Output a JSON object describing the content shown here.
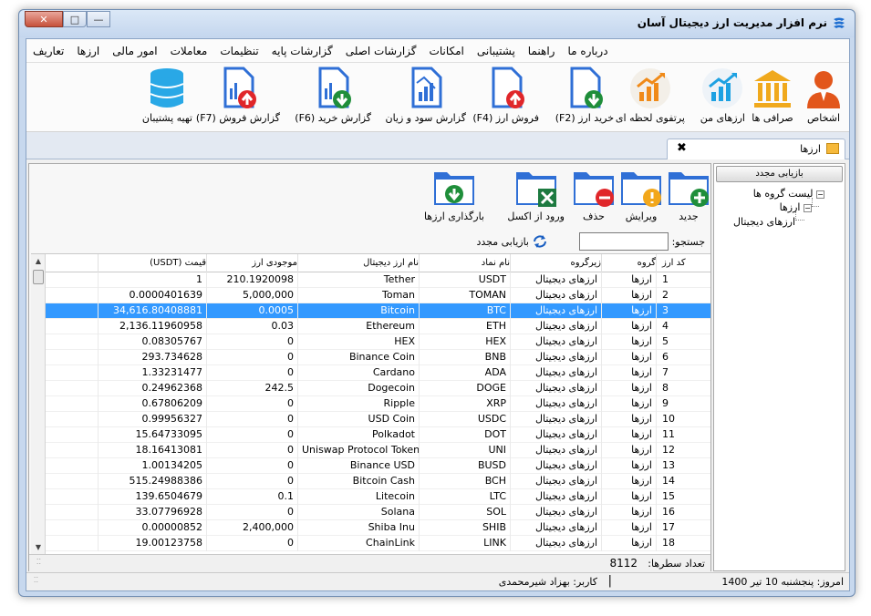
{
  "window": {
    "title": "نرم افزار مدیریت ارز دیجیتال آسان",
    "close_glyph": "✕",
    "max_glyph": "□",
    "min_glyph": "—"
  },
  "menu": [
    "تعاریف",
    "ارزها",
    "امور مالی",
    "معاملات",
    "تنظیمات",
    "گزارشات پایه",
    "گزارشات اصلی",
    "امکانات",
    "پشتیبانی",
    "راهنما",
    "درباره ما"
  ],
  "ribbon": {
    "people": "اشخاص",
    "exchanges": "صرافی ها",
    "my_coins": "ارزهای من",
    "live_portfolio": "پرتفوی لحظه ای",
    "buy": "خرید ارز (F2)",
    "sell": "فروش ارز (F4)",
    "pnl_report": "گزارش سود و زیان",
    "buy_report": "گزارش خرید (F6)",
    "sell_report": "گزارش فروش (F7)",
    "backup": "تهیه پشتیبان"
  },
  "tab": {
    "label": "ارزها",
    "close": "✖"
  },
  "tree": {
    "refresh": "بازیابی مجدد",
    "root": "لیست گروه ها",
    "group": "ارزها",
    "subgroup": "ارزهای دیجیتال",
    "expand_glyph": "−"
  },
  "actions": {
    "new": "جدید",
    "edit": "ویرایش",
    "delete": "حذف",
    "excel": "ورود از اکسل",
    "reload_coins": "بارگذاری ارزها"
  },
  "search": {
    "label": "جستجو:",
    "value": "",
    "reload": "بازیابی مجدد"
  },
  "grid": {
    "columns": [
      "کد ارز",
      "گروه",
      "زیرگروه",
      "نام نماد",
      "نام ارز دیجیتال",
      "موجودی ارز",
      "قیمت (USDT)"
    ],
    "rows": [
      {
        "code": "1",
        "group": "ارزها",
        "sub": "ارزهای دیجیتال",
        "sym": "USDT",
        "name": "Tether",
        "stock": "210.1920098",
        "price": "1"
      },
      {
        "code": "2",
        "group": "ارزها",
        "sub": "ارزهای دیجیتال",
        "sym": "TOMAN",
        "name": "Toman",
        "stock": "5,000,000",
        "price": "0.0000401639"
      },
      {
        "code": "3",
        "group": "ارزها",
        "sub": "ارزهای دیجیتال",
        "sym": "BTC",
        "name": "Bitcoin",
        "stock": "0.0005",
        "price": "34,616.80408881"
      },
      {
        "code": "4",
        "group": "ارزها",
        "sub": "ارزهای دیجیتال",
        "sym": "ETH",
        "name": "Ethereum",
        "stock": "0.03",
        "price": "2,136.11960958"
      },
      {
        "code": "5",
        "group": "ارزها",
        "sub": "ارزهای دیجیتال",
        "sym": "HEX",
        "name": "HEX",
        "stock": "0",
        "price": "0.08305767"
      },
      {
        "code": "6",
        "group": "ارزها",
        "sub": "ارزهای دیجیتال",
        "sym": "BNB",
        "name": "Binance Coin",
        "stock": "0",
        "price": "293.734628"
      },
      {
        "code": "7",
        "group": "ارزها",
        "sub": "ارزهای دیجیتال",
        "sym": "ADA",
        "name": "Cardano",
        "stock": "0",
        "price": "1.33231477"
      },
      {
        "code": "8",
        "group": "ارزها",
        "sub": "ارزهای دیجیتال",
        "sym": "DOGE",
        "name": "Dogecoin",
        "stock": "242.5",
        "price": "0.24962368"
      },
      {
        "code": "9",
        "group": "ارزها",
        "sub": "ارزهای دیجیتال",
        "sym": "XRP",
        "name": "Ripple",
        "stock": "0",
        "price": "0.67806209"
      },
      {
        "code": "10",
        "group": "ارزها",
        "sub": "ارزهای دیجیتال",
        "sym": "USDC",
        "name": "USD Coin",
        "stock": "0",
        "price": "0.99956327"
      },
      {
        "code": "11",
        "group": "ارزها",
        "sub": "ارزهای دیجیتال",
        "sym": "DOT",
        "name": "Polkadot",
        "stock": "0",
        "price": "15.64733095"
      },
      {
        "code": "12",
        "group": "ارزها",
        "sub": "ارزهای دیجیتال",
        "sym": "UNI",
        "name": "Uniswap Protocol Token",
        "stock": "0",
        "price": "18.16413081"
      },
      {
        "code": "13",
        "group": "ارزها",
        "sub": "ارزهای دیجیتال",
        "sym": "BUSD",
        "name": "Binance USD",
        "stock": "0",
        "price": "1.00134205"
      },
      {
        "code": "14",
        "group": "ارزها",
        "sub": "ارزهای دیجیتال",
        "sym": "BCH",
        "name": "Bitcoin Cash",
        "stock": "0",
        "price": "515.24988386"
      },
      {
        "code": "15",
        "group": "ارزها",
        "sub": "ارزهای دیجیتال",
        "sym": "LTC",
        "name": "Litecoin",
        "stock": "0.1",
        "price": "139.6504679"
      },
      {
        "code": "16",
        "group": "ارزها",
        "sub": "ارزهای دیجیتال",
        "sym": "SOL",
        "name": "Solana",
        "stock": "0",
        "price": "33.07796928"
      },
      {
        "code": "17",
        "group": "ارزها",
        "sub": "ارزهای دیجیتال",
        "sym": "SHIB",
        "name": "Shiba Inu",
        "stock": "2,400,000",
        "price": "0.00000852"
      },
      {
        "code": "18",
        "group": "ارزها",
        "sub": "ارزهای دیجیتال",
        "sym": "LINK",
        "name": "ChainLink",
        "stock": "0",
        "price": "19.00123758"
      }
    ],
    "selected_row": 2,
    "count_label": "تعداد سطرها:",
    "count": "8112"
  },
  "status": {
    "date": "امروز: پنجشنبه 10 تیر 1400",
    "sep": "|",
    "user": "کاربر: بهزاد شیرمحمدی"
  },
  "colors": {
    "selection": "#3399ff",
    "folder_blue": "#2f6fd6",
    "ribbon_orange": "#f08a18"
  }
}
